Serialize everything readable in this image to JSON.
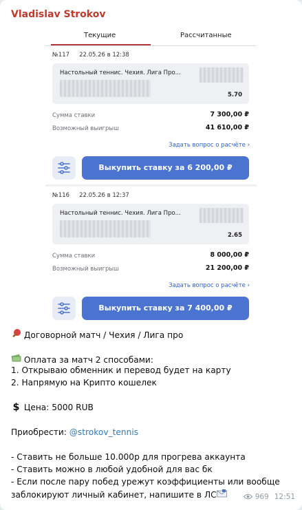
{
  "message": {
    "author": "Vladislav Strokov",
    "views": "969",
    "time": "12:51",
    "lines": {
      "l1": "Договорной матч / Чехия / Лига про",
      "l2": "Оплата за матч 2 способами:",
      "l3": "1. Открываю обменник и перевод будет на карту",
      "l4": "2. Напрямую на Крипто кошелек",
      "l5": "Цена: 5000 RUB",
      "l6_prefix": "Приобрести: ",
      "l6_handle": "@strokov_tennis",
      "l7": "- Ставить не больше 10.000р для прогрева аккаунта",
      "l8": "- Ставить можно в любой удобной для вас бк",
      "l9": "- Если после пару побед урежут коэффициенты или вообще",
      "l10": "заблокируют личный кабинет, напишите в ЛС"
    },
    "icons": {
      "l1": "ping-pong-icon",
      "l2": "money-bag-icon",
      "l5": "dollar-icon",
      "l10": "envelope-icon",
      "views": "eye-icon"
    }
  },
  "screenshot": {
    "tabs": [
      "Текущие",
      "Рассчитанные"
    ],
    "bets": [
      {
        "number": "№117",
        "date": "22.05.26 в 12:38",
        "match": "Настольный теннис. Чехия. Лига Про...",
        "odds": "5.70",
        "stake_label": "Сумма ставки",
        "stake": "7 300,00 ₽",
        "win_label": "Возможный выигрыш",
        "win": "41 610,00 ₽",
        "ask": "Задать вопрос о расчёте",
        "buyout": "Выкупить ставку за 6 200,00 ₽"
      },
      {
        "number": "№116",
        "date": "22.05.26 в 12:37",
        "match": "Настольный теннис. Чехия. Лига Про...",
        "odds": "2.65",
        "stake_label": "Сумма ставки",
        "stake": "8 000,00 ₽",
        "win_label": "Возможный выигрыш",
        "win": "21 200,00 ₽",
        "ask": "Задать вопрос о расчёте",
        "buyout": "Выкупить ставку за 7 400,00 ₽"
      }
    ]
  }
}
